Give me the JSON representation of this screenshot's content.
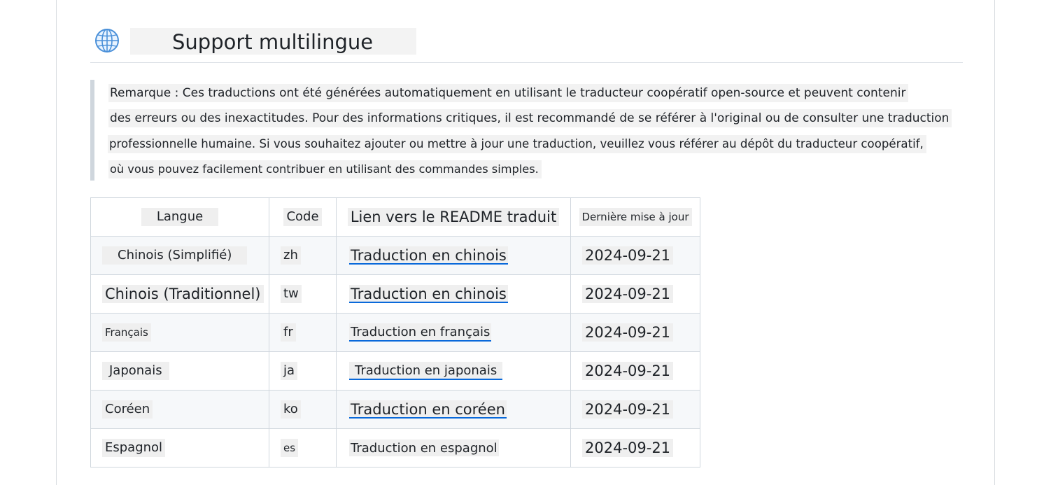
{
  "section": {
    "icon": "globe-icon",
    "title": "Support multilingue"
  },
  "note": {
    "lines": [
      "Remarque : Ces traductions ont été générées automatiquement en utilisant le traducteur coopératif open-source et peuvent contenir",
      "des erreurs ou des inexactitudes. Pour des informations critiques, il est recommandé de se référer à l'original ou de consulter une traduction",
      "professionnelle humaine. Si vous souhaitez ajouter ou mettre à jour une traduction, veuillez vous référer au dépôt du traducteur coopératif,",
      "où vous pouvez facilement contribuer en utilisant des commandes simples."
    ]
  },
  "table": {
    "headers": [
      "Langue",
      "Code",
      "Lien vers le README traduit",
      "Dernière mise à jour"
    ],
    "rows": [
      {
        "language": "Chinois (Simplifié)",
        "code": "zh",
        "link": "Traduction en chinois",
        "updated": "2024-09-21"
      },
      {
        "language": "Chinois (Traditionnel)",
        "code": "tw",
        "link": "Traduction en chinois",
        "updated": "2024-09-21"
      },
      {
        "language": "Français",
        "code": "fr",
        "link": "Traduction en français",
        "updated": "2024-09-21"
      },
      {
        "language": "Japonais",
        "code": "ja",
        "link": "Traduction en japonais",
        "updated": "2024-09-21"
      },
      {
        "language": "Coréen",
        "code": "ko",
        "link": "Traduction en coréen",
        "updated": "2024-09-21"
      },
      {
        "language": "Espagnol",
        "code": "es",
        "link": "Traduction en espagnol",
        "updated": "2024-09-21"
      }
    ]
  },
  "colors": {
    "link_underline": "#0969da",
    "blockquote_bar": "#cfd6dd",
    "globe": "#4a90d9"
  }
}
